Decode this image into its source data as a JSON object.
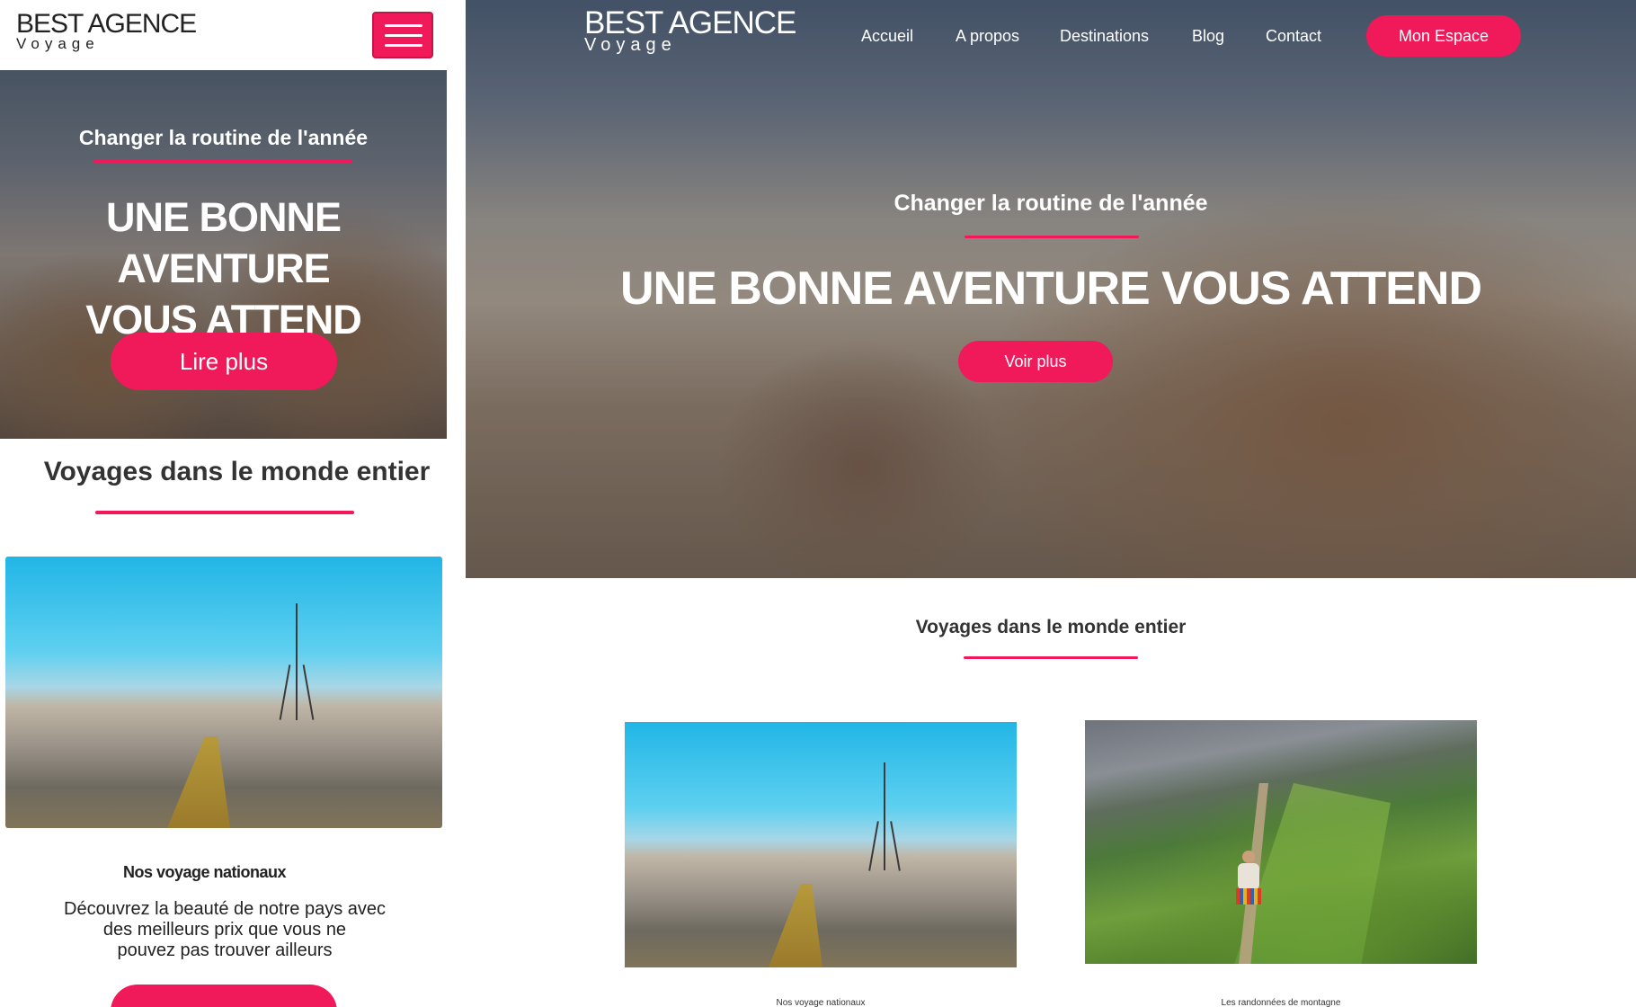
{
  "mobile": {
    "logo": {
      "line1": "BEST AGENCE",
      "line2": "Voyage"
    },
    "menu_icon": "hamburger-icon",
    "hero": {
      "subtitle": "Changer la routine de l'année",
      "title_line1": "UNE BONNE AVENTURE",
      "title_line2": "VOUS ATTEND",
      "button": "Lire plus"
    },
    "section": {
      "title": "Voyages dans le monde entier"
    },
    "card": {
      "title": "Nos voyage nationaux",
      "text_line1": "Découvrez la beauté de notre pays avec",
      "text_line2": "des meilleurs prix que vous ne",
      "text_line3": "pouvez pas trouver ailleurs"
    }
  },
  "desktop": {
    "logo": {
      "line1": "BEST AGENCE",
      "line2": "Voyage"
    },
    "nav": {
      "items": [
        "Accueil",
        "A propos",
        "Destinations",
        "Blog",
        "Contact"
      ],
      "cta": "Mon Espace"
    },
    "hero": {
      "subtitle": "Changer la routine de l'année",
      "title": "UNE BONNE AVENTURE VOUS ATTEND",
      "button": "Voir plus"
    },
    "section": {
      "title": "Voyages dans le monde entier"
    },
    "cards": [
      {
        "caption": "Nos voyage nationaux"
      },
      {
        "caption": "Les randonnées de montagne"
      }
    ]
  },
  "colors": {
    "accent": "#f0195a",
    "text_dark": "#333333",
    "white": "#ffffff"
  }
}
